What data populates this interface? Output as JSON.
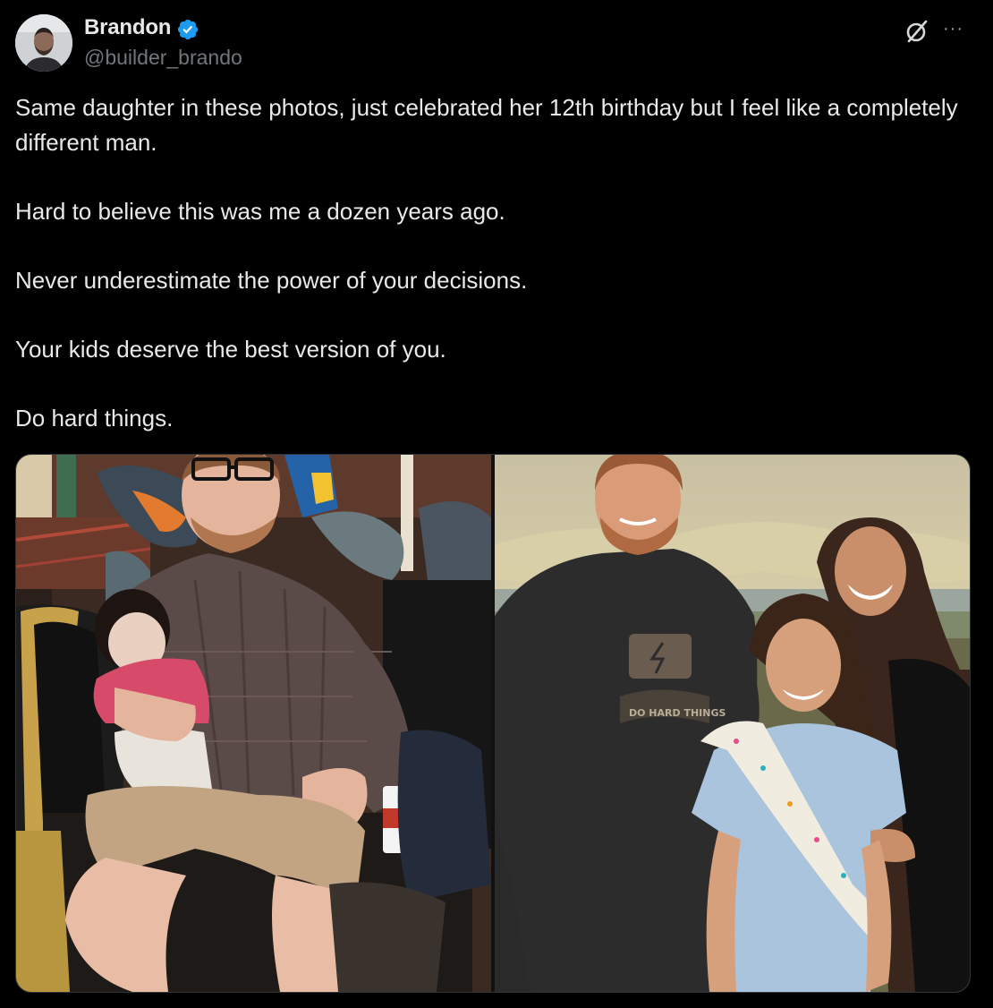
{
  "author": {
    "name": "Brandon",
    "handle": "@builder_brando",
    "verified": true,
    "avatar_icon": "profile-avatar"
  },
  "header_icons": {
    "grok": "grok-icon",
    "more": "more-icon",
    "more_glyph": "···"
  },
  "tweet": {
    "paragraphs": [
      "Same daughter in these photos, just celebrated her 12th birthday but I feel like a completely different man.",
      "Hard to believe this was me a dozen years ago.",
      "Never underestimate the power of your decisions.",
      "Your kids deserve the best version of you.",
      "Do hard things."
    ]
  },
  "media": {
    "left_photo": {
      "semantic": "then-photo-man-holding-baby-on-carousel"
    },
    "right_photo": {
      "semantic": "now-photo-family-at-beach",
      "shirt_text": "DO HARD THINGS"
    }
  },
  "colors": {
    "background": "#000000",
    "text": "#e7e9ea",
    "secondary": "#71767b",
    "verified": "#1d9bf0"
  }
}
